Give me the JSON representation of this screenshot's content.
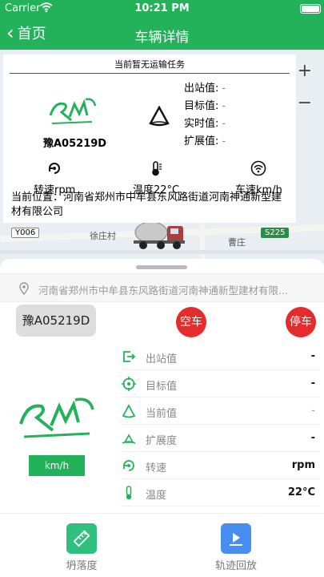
{
  "status": {
    "carrier": "Carrier",
    "time": "10:21 PM"
  },
  "nav": {
    "back_label": "首页",
    "title": "车辆详情"
  },
  "map": {
    "road_y006": "Y006",
    "village1": "徐庄村",
    "village2": "曹庄",
    "road_s225": "S225"
  },
  "info": {
    "task": "当前暂无运输任务",
    "plate": "豫A05219D",
    "labels": [
      "出站值:",
      "目标值:",
      "实时值:",
      "扩展值:"
    ],
    "values": [
      "-",
      "-",
      "-",
      "-"
    ],
    "rotation": "转速rpm",
    "temperature": "温度22°C",
    "speed": "车速km/h",
    "location": "当前位置：河南省郑州市中牟县东风路街道河南神通新型建材有限公司"
  },
  "zoom": {
    "plus": "+",
    "minus": "−"
  },
  "sheet": {
    "address": "河南省郑州市中牟县东风路街道河南神通新型建材有限...",
    "plate": "豫A05219D",
    "empty_label": "空车",
    "stop_label": "停车",
    "speed_tag": "km/h",
    "rows": [
      {
        "label": "出站值",
        "value": "-"
      },
      {
        "label": "目标值",
        "value": "-"
      },
      {
        "label": "当前值",
        "value": "-"
      },
      {
        "label": "扩展度",
        "value": "-"
      },
      {
        "label": "转速",
        "value": "rpm"
      },
      {
        "label": "温度",
        "value": "22°C"
      }
    ],
    "footer": {
      "slump": "坍落度",
      "track": "轨迹回放"
    }
  },
  "colors": {
    "brand": "#23b25a",
    "danger": "#e52b2b",
    "track": "#4a8df0"
  }
}
